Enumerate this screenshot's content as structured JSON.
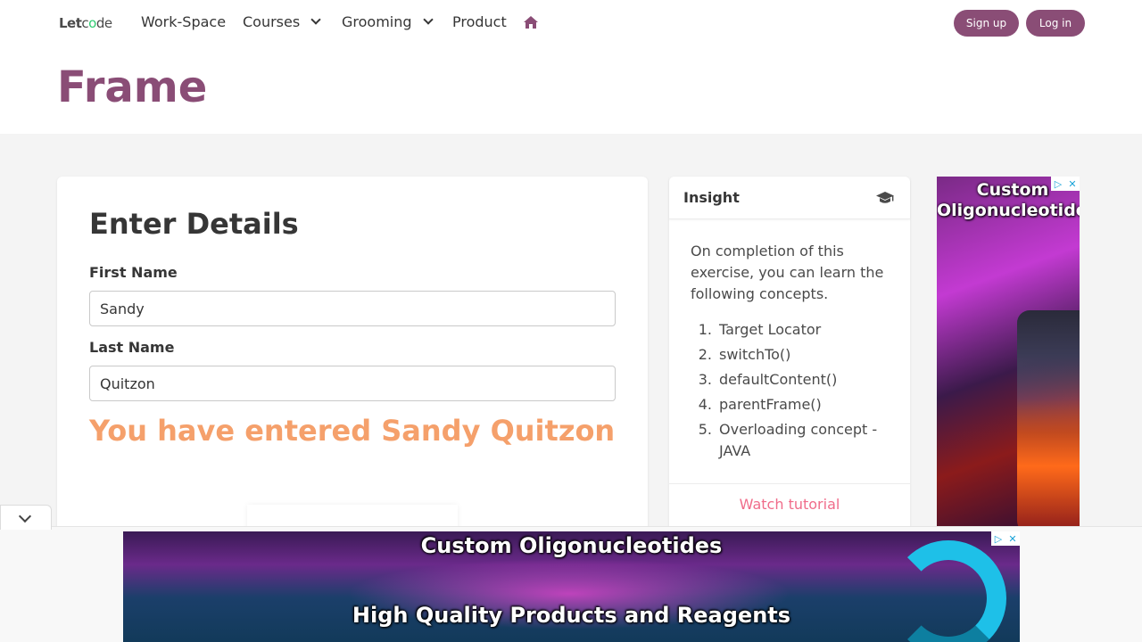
{
  "nav": {
    "logo": {
      "part1": "Let",
      "part2": "c",
      "part3": "o",
      "part4": "de"
    },
    "items": [
      {
        "label": "Work-Space"
      },
      {
        "label": "Courses"
      },
      {
        "label": "Grooming"
      },
      {
        "label": "Product"
      }
    ],
    "signup_label": "Sign up",
    "login_label": "Log in",
    "accent_color": "#8a4d76"
  },
  "hero": {
    "title": "Frame"
  },
  "form": {
    "title": "Enter Details",
    "first_name_label": "First Name",
    "first_name_value": "Sandy",
    "last_name_label": "Last Name",
    "last_name_value": "Quitzon",
    "result_text": "You have entered Sandy Quitzon",
    "result_color": "#f5a06b"
  },
  "insight": {
    "title": "Insight",
    "icon": "graduation-cap-icon",
    "intro": "On completion of this exercise, you can learn the following concepts.",
    "concepts": [
      {
        "num": "1.",
        "text": "Target Locator"
      },
      {
        "num": "2.",
        "text": "switchTo()"
      },
      {
        "num": "3.",
        "text": "defaultContent()"
      },
      {
        "num": "4.",
        "text": "parentFrame()"
      },
      {
        "num": "5.",
        "text": "Overloading concept - JAVA"
      }
    ],
    "watch_label": "Watch tutorial",
    "watch_color": "#f06c8a"
  },
  "ads": {
    "side_text": "Custom Oligonucleotides",
    "bottom_line1": "Custom Oligonucleotides",
    "bottom_line2": "High Quality Products and Reagents"
  }
}
